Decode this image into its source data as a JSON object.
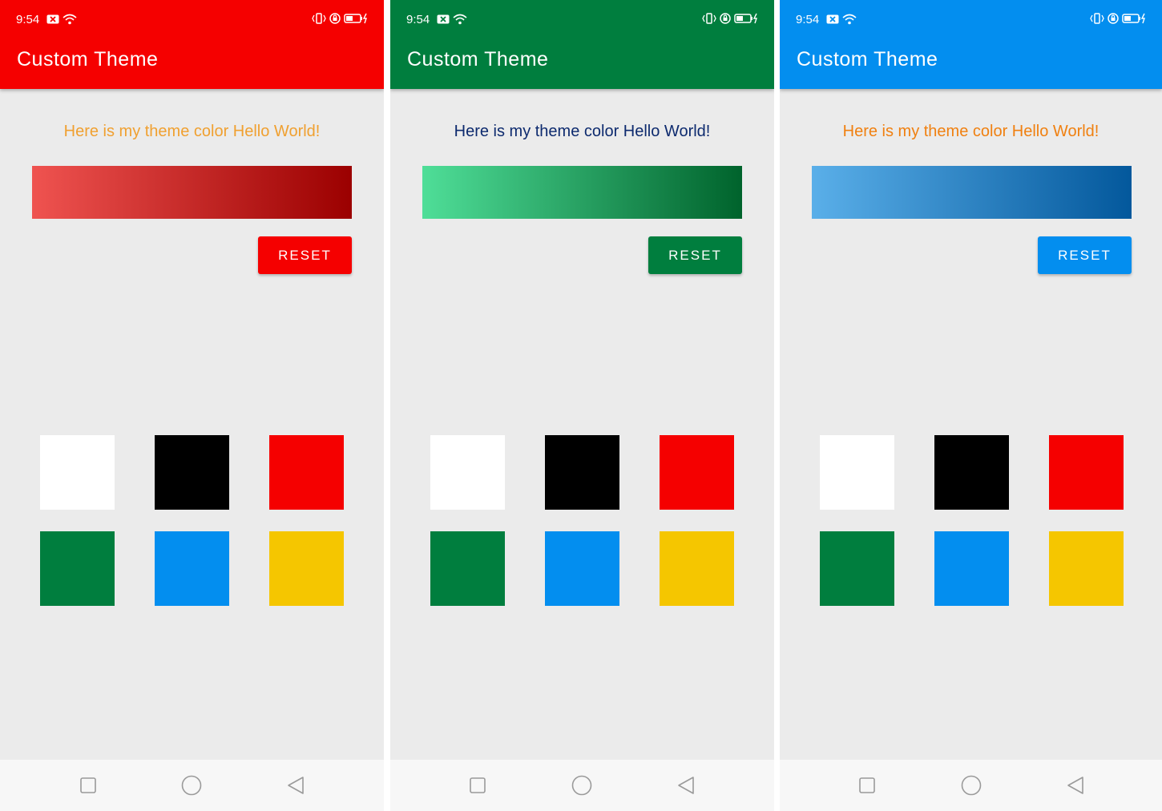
{
  "screens": [
    {
      "status": {
        "time": "9:54"
      },
      "appbar": {
        "title": "Custom Theme",
        "color": "#f50000"
      },
      "hello_text": "Here is my theme color Hello World!",
      "hello_color": "#f0a030",
      "gradient": {
        "from": "#ef5350",
        "to": "#9b0000"
      },
      "reset": {
        "label": "RESET",
        "color": "#f50000"
      }
    },
    {
      "status": {
        "time": "9:54"
      },
      "appbar": {
        "title": "Custom Theme",
        "color": "#007e3e"
      },
      "hello_text": "Here is my theme color Hello World!",
      "hello_color": "#0d2a6e",
      "gradient": {
        "from": "#4fde98",
        "to": "#00632c"
      },
      "reset": {
        "label": "RESET",
        "color": "#007e3e"
      }
    },
    {
      "status": {
        "time": "9:54"
      },
      "appbar": {
        "title": "Custom Theme",
        "color": "#038eef"
      },
      "hello_text": "Here is my theme color Hello World!",
      "hello_color": "#f08010",
      "gradient": {
        "from": "#5aafe9",
        "to": "#03589c"
      },
      "reset": {
        "label": "RESET",
        "color": "#038eef"
      }
    }
  ],
  "swatches": [
    {
      "name": "white",
      "color": "#ffffff"
    },
    {
      "name": "black",
      "color": "#000000"
    },
    {
      "name": "red",
      "color": "#f50000"
    },
    {
      "name": "green",
      "color": "#007e3e"
    },
    {
      "name": "blue",
      "color": "#038eef"
    },
    {
      "name": "yellow",
      "color": "#f5c600"
    }
  ],
  "icons": {
    "status_left": [
      "notification-x-icon",
      "wifi-icon"
    ],
    "status_right": [
      "vibrate-icon",
      "lock-rotation-icon",
      "battery-charging-icon"
    ],
    "nav": [
      "recents-square-icon",
      "home-circle-icon",
      "back-triangle-icon"
    ]
  }
}
